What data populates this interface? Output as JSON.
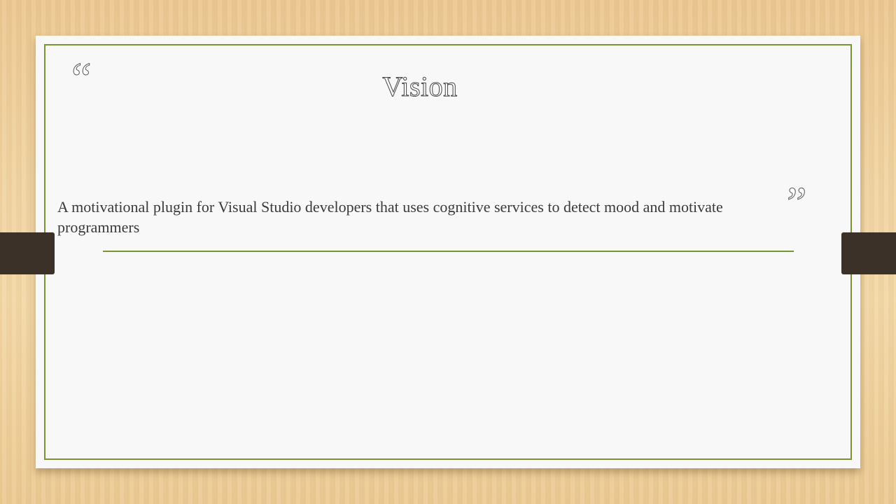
{
  "slide": {
    "title": "Vision",
    "body": "A motivational plugin for Visual Studio developers that uses cognitive services to detect mood and motivate programmers",
    "open_quote": "“",
    "close_quote": "”"
  },
  "colors": {
    "frame_accent": "#7a9431",
    "tab": "#3b3128",
    "background_wood": "#f1d6a6",
    "slide": "#f8f8f8"
  }
}
